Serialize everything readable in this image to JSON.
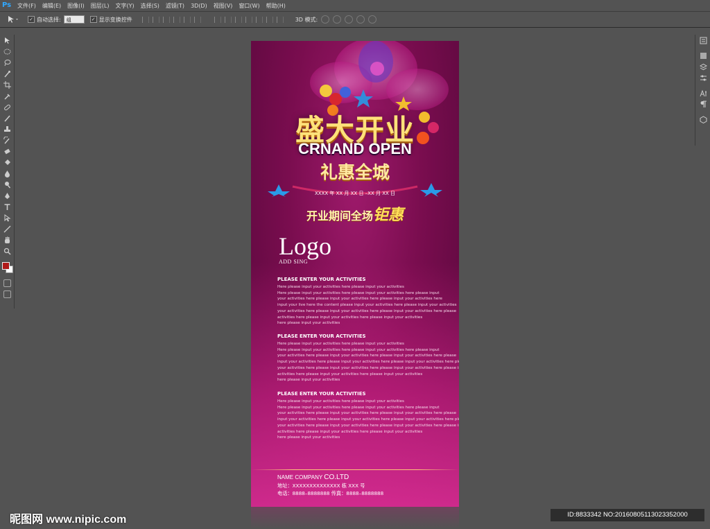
{
  "app": {
    "logo": "Ps"
  },
  "menubar": {
    "items": [
      "文件(F)",
      "编辑(E)",
      "图像(I)",
      "图层(L)",
      "文字(Y)",
      "选择(S)",
      "滤镜(T)",
      "3D(D)",
      "视图(V)",
      "窗口(W)",
      "帮助(H)"
    ]
  },
  "options": {
    "auto_select_label": "自动选择:",
    "auto_select_value": "组",
    "show_transform_label": "显示变换控件",
    "mode_3d_label": "3D 模式:"
  },
  "toolbar": {
    "tools": [
      "move-tool-icon",
      "marquee-tool-icon",
      "lasso-tool-icon",
      "quick-select-tool-icon",
      "crop-tool-icon",
      "eyedropper-tool-icon",
      "healing-brush-tool-icon",
      "brush-tool-icon",
      "clone-stamp-tool-icon",
      "history-brush-tool-icon",
      "eraser-tool-icon",
      "paint-bucket-tool-icon",
      "blur-tool-icon",
      "dodge-tool-icon",
      "pen-tool-icon",
      "type-tool-icon",
      "path-select-tool-icon",
      "line-tool-icon",
      "hand-tool-icon",
      "zoom-tool-icon"
    ],
    "foreground_color": "#b01a1a",
    "background_color": "#ffffff"
  },
  "poster": {
    "title_cn": "盛大开业",
    "title_en": "CRNAND OPEN",
    "title_sub": "礼惠全城",
    "dates": "XXXX 年 XX 月 XX 日 –XX 月 XX 日",
    "promo_prefix": "开业期间全场",
    "promo_big": "钜惠",
    "logo": "Logo",
    "logo_sub": "ADD SING",
    "blocks": [
      {
        "heading": "PLEASE ENTER YOUR ACTIVITIES",
        "lines": [
          "Here please input your activities here please input your activities",
          "Here please input your activities here please input your activities here please input",
          "your activities here please input your activities here please input your activities here",
          "input your live here the content please input your activities here please input your activities",
          "your activities here please input your activities here please input your activities here please",
          " activities here please input your activities here please input your activities",
          "here please input your activities"
        ]
      },
      {
        "heading": "PLEASE ENTER YOUR ACTIVITIES",
        "lines": [
          "Here please input your activities here please input your activities",
          "Here please input your activities here please input your activities here please input",
          "your activities here please input your activities here please input your activities here please",
          "input your activities here please input your activities here please input your activities here please",
          "your activities here please input your activities here please input your activities here please input",
          " activities here please input your activities here please input your activities",
          "here please input your activities"
        ]
      },
      {
        "heading": "PLEASE ENTER YOUR ACTIVITIES",
        "lines": [
          "Here please input your activities here please input your activities",
          "Here please input your activities here please input your activities here please input",
          "your activities here please input your activities here please input your activities here please",
          "input your activities here please input your activities here please input your activities here please",
          "your activities here please input your activities here please input your activities here please input",
          " activities here please input your activities here please input your activities",
          "here please input your activities"
        ]
      }
    ],
    "company_prefix": "NAME COMPANY ",
    "company_suffix": "CO.LTD",
    "address": "地址：XXXXXXXXXXXXXX 栋 XXX 号",
    "phone": "电话：8888–8888888   传真：8888–8888888"
  },
  "watermark": {
    "site": "昵图网 www.nipic.com",
    "id": "ID:8833342 NO:20160805113023352000"
  }
}
